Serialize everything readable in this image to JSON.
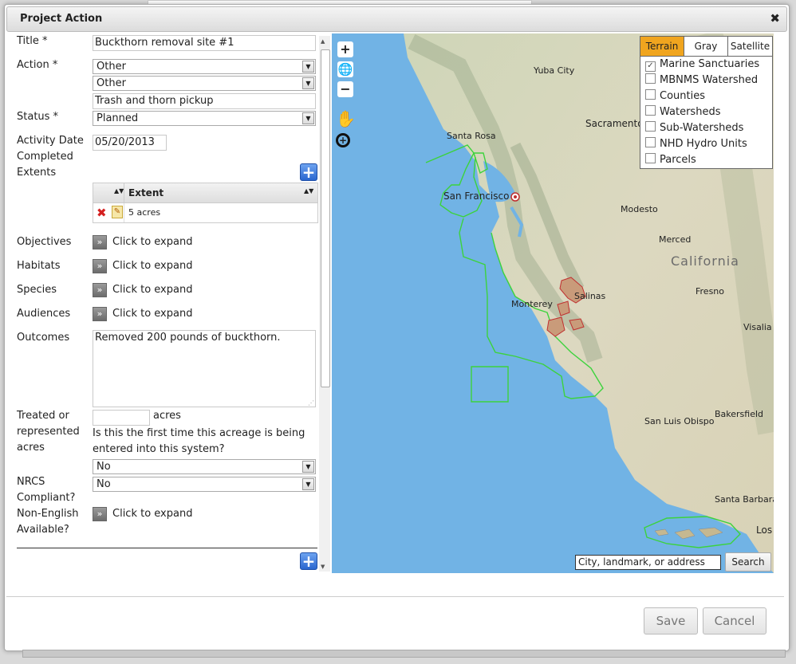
{
  "dialog": {
    "title": "Project Action"
  },
  "form": {
    "title_label": "Title *",
    "title_value": "Buckthorn removal site #1",
    "action_label": "Action *",
    "action_select1": "Other",
    "action_select2": "Other",
    "action_text": "Trash and thorn pickup",
    "status_label": "Status *",
    "status_value": "Planned",
    "activity_date_label": "Activity Date",
    "activity_date_value": "05/20/2013",
    "completed_label": "Completed",
    "extents_label": "Extents",
    "extents_header": "Extent",
    "extents_rows": [
      "5 acres"
    ],
    "objectives_label": "Objectives",
    "habitats_label": "Habitats",
    "species_label": "Species",
    "audiences_label": "Audiences",
    "expand_text": "Click to expand",
    "outcomes_label": "Outcomes",
    "outcomes_value": "Removed 200 pounds of buckthorn.",
    "treated_label_1": "Treated or",
    "treated_label_2": "represented",
    "treated_label_3": "acres",
    "acres_unit": "acres",
    "first_time_q1": "Is this the first time this acreage is being",
    "first_time_q2": "entered into this system?",
    "first_time_value": "No",
    "nrcs_label_1": "NRCS",
    "nrcs_label_2": "Compliant?",
    "nrcs_value": "No",
    "nonenglish_label_1": "Non-English",
    "nonenglish_label_2": "Available?"
  },
  "map": {
    "tabs": [
      "Terrain",
      "Gray",
      "Satellite"
    ],
    "active_tab": "Terrain",
    "layers": [
      {
        "name": "Marine Sanctuaries",
        "checked": true
      },
      {
        "name": "MBNMS Watershed",
        "checked": false
      },
      {
        "name": "Counties",
        "checked": false
      },
      {
        "name": "Watersheds",
        "checked": false
      },
      {
        "name": "Sub-Watersheds",
        "checked": false
      },
      {
        "name": "NHD Hydro Units",
        "checked": false
      },
      {
        "name": "Parcels",
        "checked": false
      }
    ],
    "search_placeholder": "City, landmark, or address",
    "search_button": "Search",
    "places": {
      "yuba": "Yuba City",
      "sacramento": "Sacramento",
      "santarosa": "Santa Rosa",
      "sf": "San Francisco",
      "modesto": "Modesto",
      "merced": "Merced",
      "california": "California",
      "fresno": "Fresno",
      "salinas": "Salinas",
      "monterey": "Monterey",
      "visalia": "Visalia",
      "bakersfield": "Bakersfield",
      "slo": "San Luis Obispo",
      "santabarbara": "Santa Barbara",
      "los": "Los"
    }
  },
  "footer": {
    "save": "Save",
    "cancel": "Cancel"
  }
}
